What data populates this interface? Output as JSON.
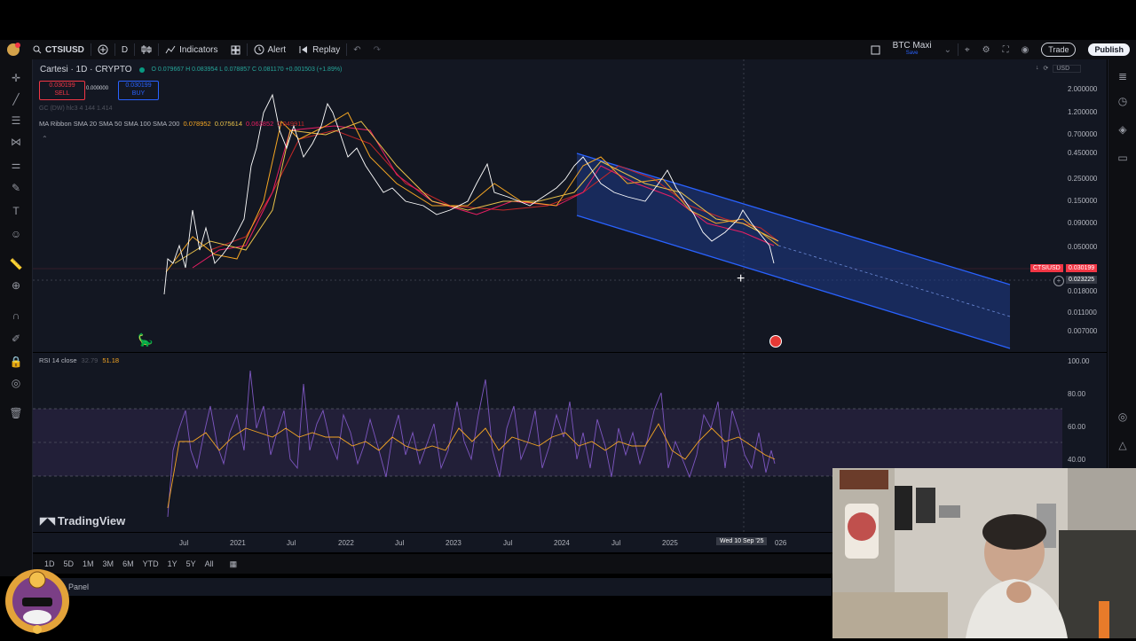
{
  "toolbar": {
    "symbol": "CTSIUSD",
    "interval": "D",
    "indicators": "Indicators",
    "alert": "Alert",
    "replay": "Replay",
    "watchlist_name": "BTC Maxi",
    "watchlist_sub": "Save",
    "trade": "Trade",
    "publish": "Publish"
  },
  "legend": {
    "title": "Cartesi · 1D · CRYPTO",
    "ohlc": "O 0.079667  H 0.083954  L 0.078857  C 0.081170  +0.001503 (+1.89%)",
    "sell_price": "0.030199",
    "sell_label": "SELL",
    "spread": "0.000000",
    "buy_price": "0.030199",
    "buy_label": "BUY",
    "indicator1": "GC (DW) hlc3 4 144 1.414",
    "ma_label": "MA Ribbon SMA 20 SMA 50 SMA 100 SMA 200",
    "ma_values": [
      "0.078952",
      "0.075614",
      "0.063852",
      "0.049911"
    ],
    "rsi_label": "RSI 14 close",
    "rsi_values": [
      "32.79",
      "51.18"
    ]
  },
  "price_axis": {
    "currency": "USD",
    "ticks": [
      "2.000000",
      "1.200000",
      "0.700000",
      "0.450000",
      "0.250000",
      "0.150000",
      "0.090000",
      "0.050000",
      "0.018000",
      "0.011000",
      "0.007000"
    ],
    "symbol_tag": "CTSIUSD",
    "last_price": "0.030199",
    "crosshair_price": "0.023225"
  },
  "rsi_axis": {
    "ticks": [
      "100.00",
      "80.00",
      "60.00",
      "40.00"
    ]
  },
  "time_axis": {
    "ticks": [
      "Jul",
      "2021",
      "Jul",
      "2022",
      "Jul",
      "2023",
      "Jul",
      "2024",
      "Jul",
      "2025"
    ],
    "crosshair_date": "Wed 10 Sep '25",
    "tail_label": "026"
  },
  "branding": "TradingView",
  "timeframes": [
    "1D",
    "5D",
    "1M",
    "3M",
    "6M",
    "YTD",
    "1Y",
    "5Y",
    "All"
  ],
  "panel_label": "Panel",
  "colors": {
    "background": "#131722",
    "channel_fill": "#1e3a8a",
    "channel_line": "#2962ff",
    "price_line": "#ffffff",
    "sma20": "#f5a623",
    "sma50": "#e8c14a",
    "sma100": "#e91e63",
    "sma200": "#c62828",
    "rsi_line": "#7e57c2",
    "rsi_ma": "#f5a623",
    "sell": "#f23645",
    "buy": "#2962ff"
  },
  "icons": [
    "search-icon",
    "plus-icon",
    "bars-icon",
    "indicators-icon",
    "layout-icon",
    "alert-icon",
    "replay-icon",
    "undo-icon",
    "redo-icon",
    "crosshair-icon",
    "trendline-icon",
    "fib-icon",
    "pattern-icon",
    "brush-icon",
    "text-icon",
    "emoji-icon",
    "ruler-icon",
    "zoom-icon",
    "magnet-icon",
    "lock-icon",
    "eye-icon",
    "trash-icon",
    "camera-icon",
    "fullscreen-icon",
    "settings-icon",
    "watchlist-icon",
    "clock-icon",
    "layers-icon",
    "chat-icon",
    "calendar-icon"
  ]
}
